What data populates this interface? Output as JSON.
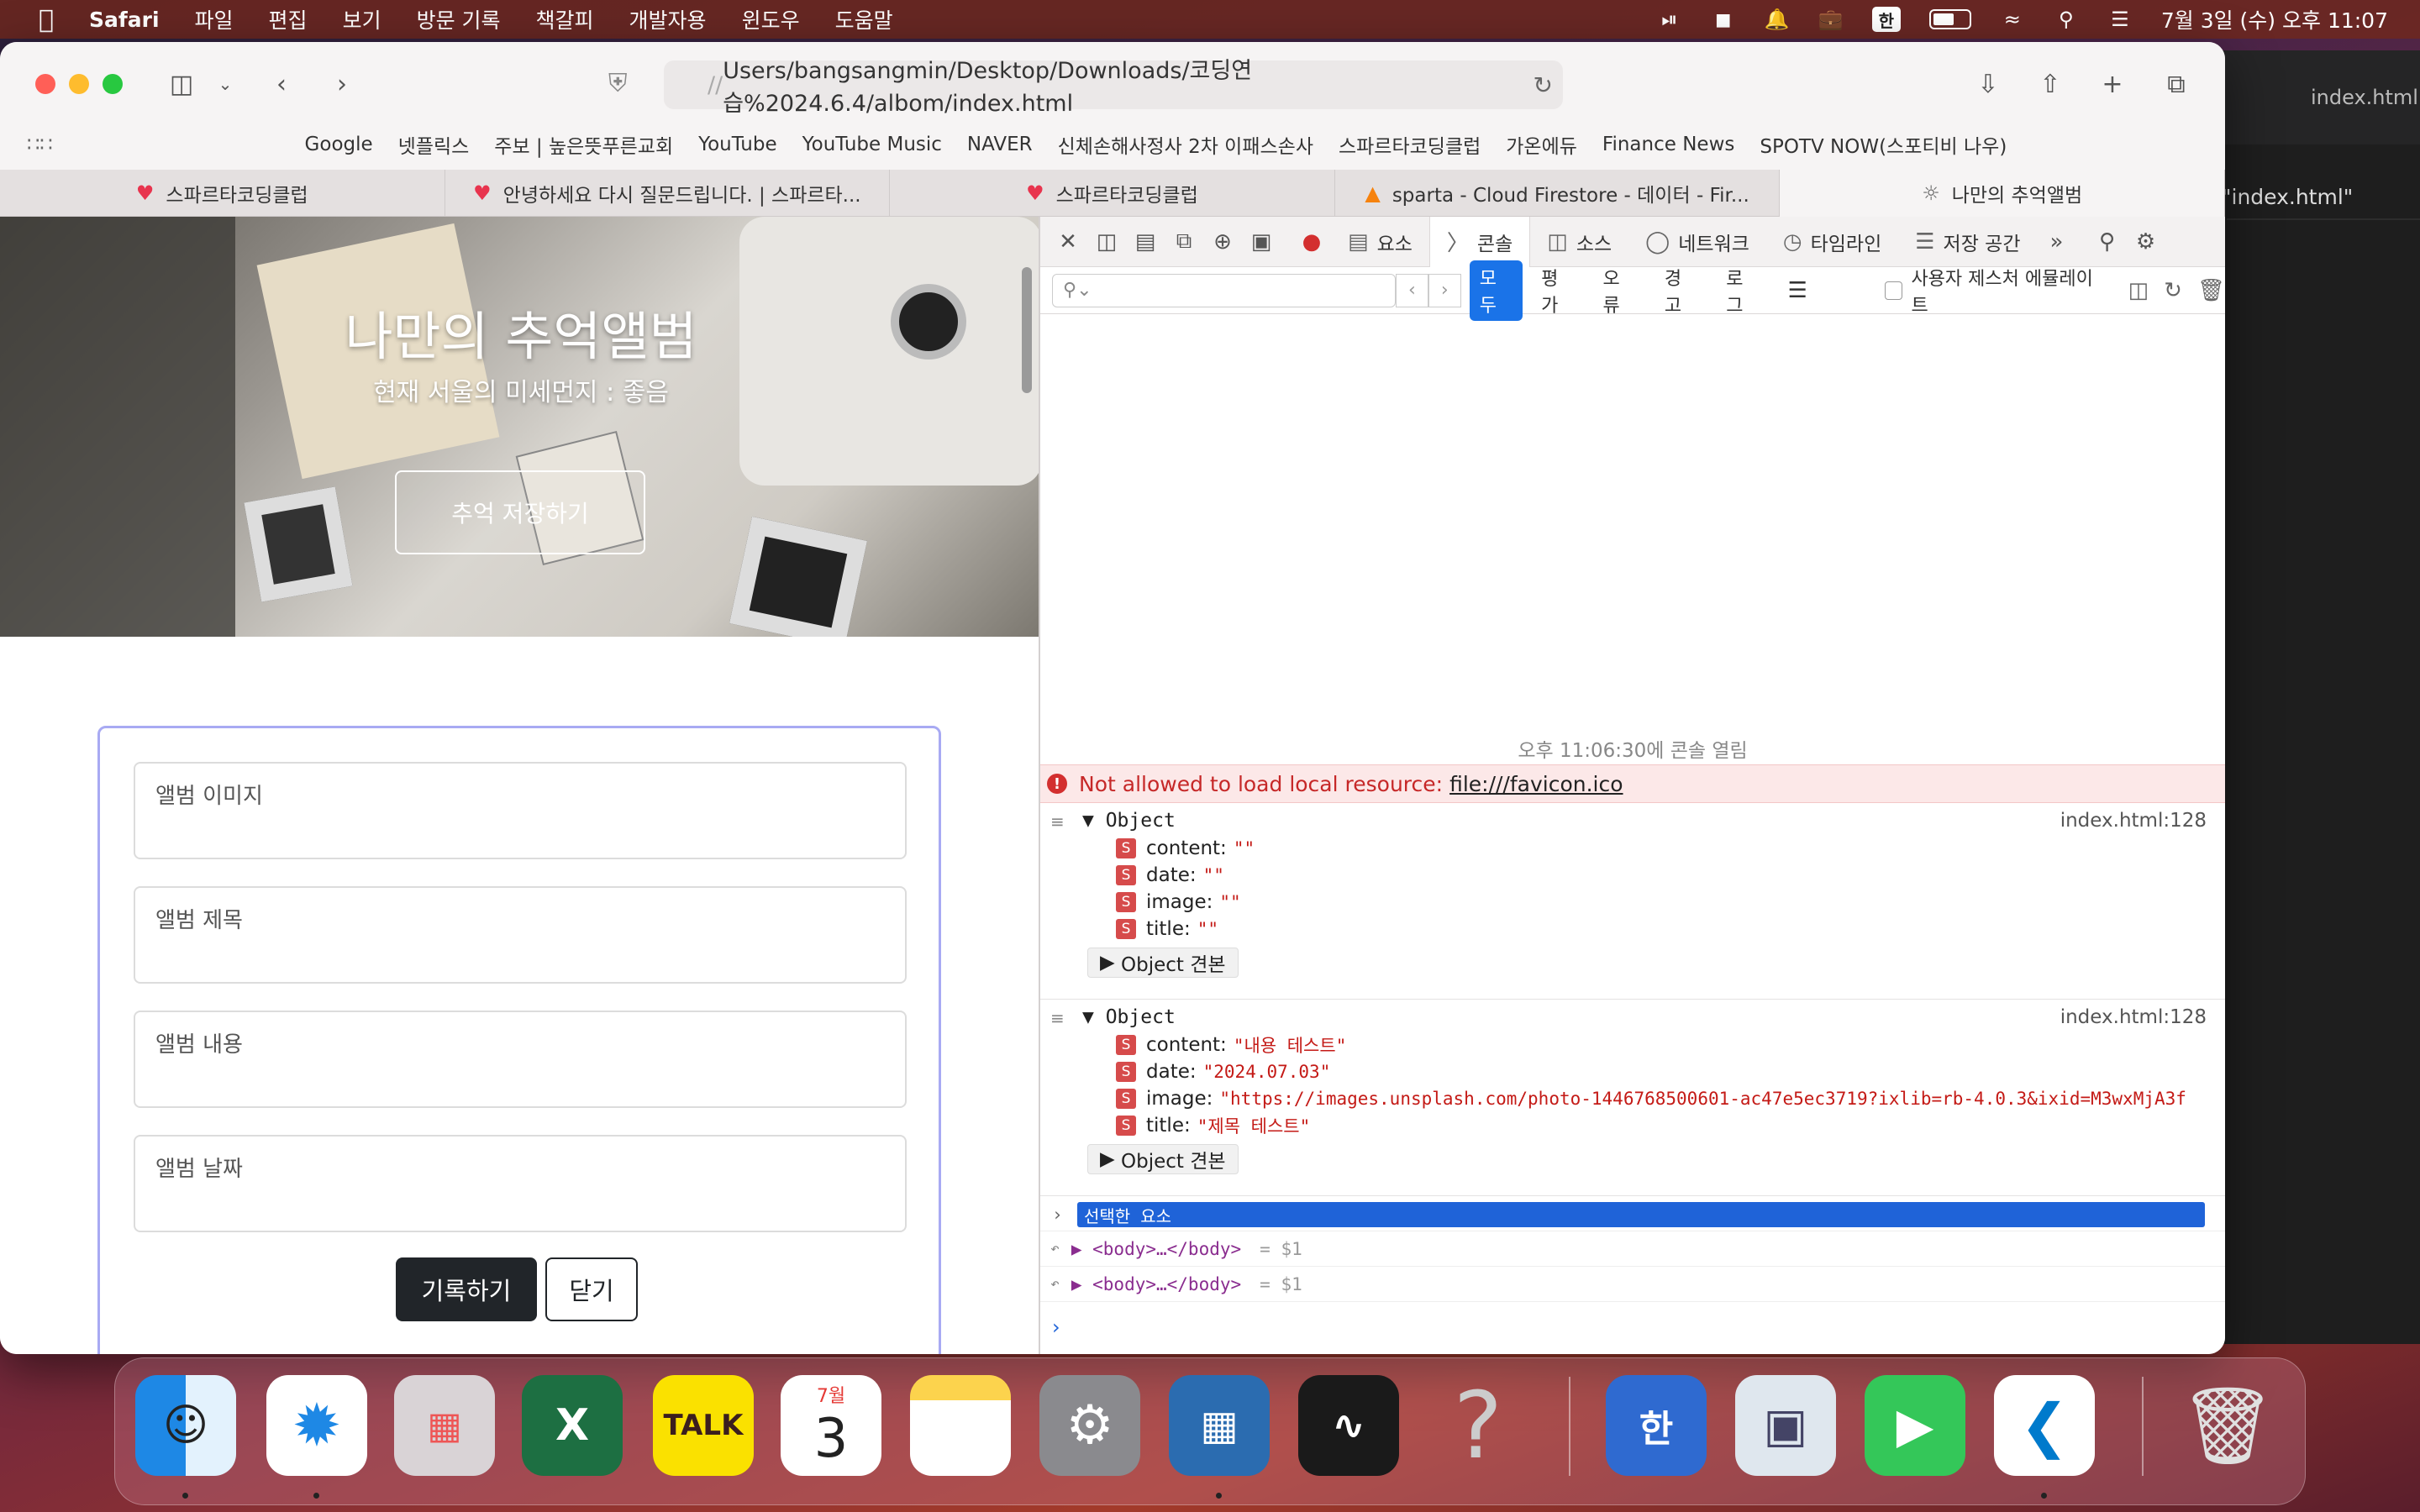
{
  "menubar": {
    "app": "Safari",
    "items": [
      "파일",
      "편집",
      "보기",
      "방문 기록",
      "책갈피",
      "개발자용",
      "윈도우",
      "도움말"
    ],
    "ime": "한",
    "clock": "7월 3일 (수) 오후 11:07"
  },
  "background_window": {
    "title": "index.html",
    "breadcrumb": "\"index.html\""
  },
  "safari": {
    "url_faded": "//",
    "url": "Users/bangsangmin/Desktop/Downloads/코딩연습%2024.6.4/albom/index.html",
    "favorites": [
      "Google",
      "넷플릭스",
      "주보 | 높은뜻푸른교회",
      "YouTube",
      "YouTube Music",
      "NAVER",
      "신체손해사정사 2차 이패스손사",
      "스파르타코딩클럽",
      "가온에듀",
      "Finance News",
      "SPOTV NOW(스포티비 나우)"
    ],
    "tabs": [
      {
        "label": "스파르타코딩클럽",
        "icon": "sparta-icon"
      },
      {
        "label": "안녕하세요 다시 질문드립니다. | 스파르타...",
        "icon": "sparta-icon"
      },
      {
        "label": "스파르타코딩클럽",
        "icon": "sparta-icon"
      },
      {
        "label": "sparta - Cloud Firestore - 데이터 - Fir...",
        "icon": "firebase-icon"
      },
      {
        "label": "나만의 추억앨범",
        "icon": "compass-icon"
      }
    ]
  },
  "page": {
    "title": "나만의 추억앨범",
    "subtitle": "현재 서울의 미세먼지 : 좋음",
    "save_button": "추억 저장하기",
    "fields": {
      "image": "앨범 이미지",
      "title": "앨범 제목",
      "content": "앨범 내용",
      "date": "앨범 날짜"
    },
    "submit": "기록하기",
    "close": "닫기"
  },
  "devtools": {
    "tabs": [
      "요소",
      "콘솔",
      "소스",
      "네트워크",
      "타임라인",
      "저장 공간"
    ],
    "filters": [
      "모두",
      "평가",
      "오류",
      "경고",
      "로그"
    ],
    "emulate_label": "사용자 제스처 에뮬레이트",
    "opened_msg": "오후 11:06:30에 콘솔 열림",
    "error": {
      "text": "Not allowed to load local resource:",
      "link": "file:///favicon.ico"
    },
    "objects": [
      {
        "label": "Object",
        "source": "index.html:128",
        "props": [
          {
            "key": "content:",
            "value": "\"\""
          },
          {
            "key": "date:",
            "value": "\"\""
          },
          {
            "key": "image:",
            "value": "\"\""
          },
          {
            "key": "title:",
            "value": "\"\""
          }
        ],
        "proto": "Object 견본"
      },
      {
        "label": "Object",
        "source": "index.html:128",
        "props": [
          {
            "key": "content:",
            "value": "\"내용 테스트\""
          },
          {
            "key": "date:",
            "value": "\"2024.07.03\""
          },
          {
            "key": "image:",
            "value": "\"https://images.unsplash.com/photo-1446768500601-ac47e5ec3719?ixlib=rb-4.0.3&ixid=M3wxMjA3f"
          },
          {
            "key": "title:",
            "value": "\"제목 테스트\""
          }
        ],
        "proto": "Object 견본"
      }
    ],
    "selected_label": "선택한 요소",
    "results": [
      {
        "tag": "<body>…</body>",
        "ref": "= $1"
      },
      {
        "tag": "<body>…</body>",
        "ref": "= $1"
      }
    ]
  },
  "dock": {
    "calendar_month": "7월",
    "calendar_day": "3",
    "talk_label": "TALK"
  }
}
